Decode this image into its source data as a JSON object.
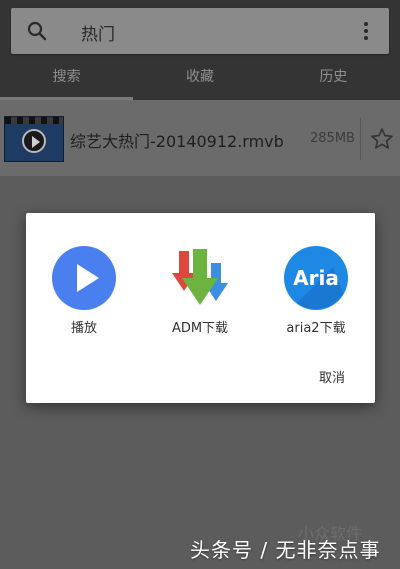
{
  "search": {
    "query": "热门"
  },
  "tabs": [
    {
      "label": "搜索",
      "active": true
    },
    {
      "label": "收藏",
      "active": false
    },
    {
      "label": "历史",
      "active": false
    }
  ],
  "list": {
    "items": [
      {
        "filename": "综艺大热门-20140912.rmvb",
        "size": "285MB",
        "thumbnail_icon": "video-file-icon",
        "favorite": false
      }
    ]
  },
  "dialog": {
    "options": [
      {
        "label": "播放",
        "icon": "play-icon",
        "color": "#4a7ff0"
      },
      {
        "label": "ADM下载",
        "icon": "adm-download-icon",
        "color": "#6db33f"
      },
      {
        "label": "aria2下载",
        "icon": "aria2-icon",
        "icon_text": "Aria",
        "color": "#1e88e5"
      }
    ],
    "cancel_label": "取消"
  },
  "watermark": {
    "text": "头条号 / 无非奈点事",
    "faint_text": "小众软件"
  },
  "colors": {
    "overlay_bg": "#5c5c5c",
    "dialog_bg": "#ffffff",
    "play_blue": "#4a7ff0"
  }
}
